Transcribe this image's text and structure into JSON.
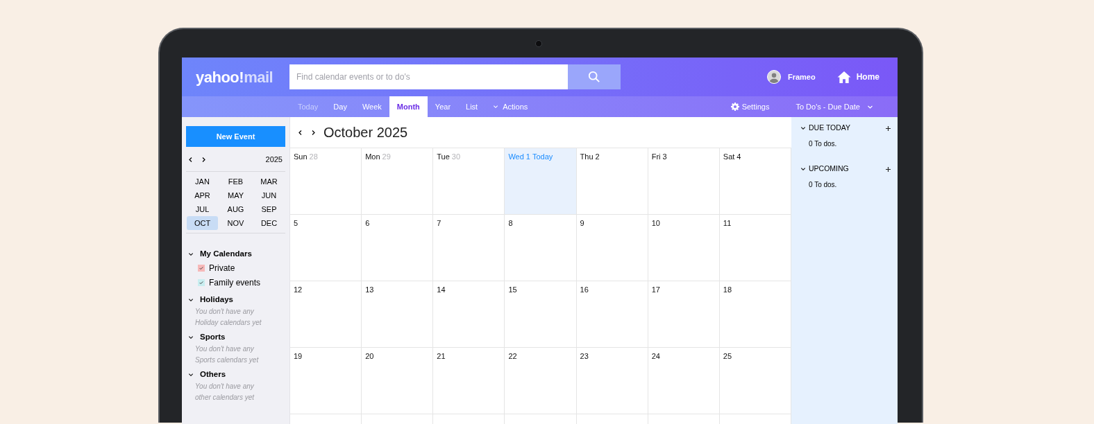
{
  "header": {
    "logo": {
      "brand": "yahoo!",
      "product": "mail"
    },
    "search": {
      "placeholder": "Find calendar events or to do's"
    },
    "account": {
      "name": "Frameo"
    },
    "home": {
      "label": "Home"
    }
  },
  "toolbar": {
    "tabs": [
      {
        "label": "Today",
        "selected": false,
        "disabled": true,
        "kind": "tab"
      },
      {
        "label": "Day",
        "selected": false,
        "disabled": false,
        "kind": "tab"
      },
      {
        "label": "Week",
        "selected": false,
        "disabled": false,
        "kind": "tab"
      },
      {
        "label": "Month",
        "selected": true,
        "disabled": false,
        "kind": "tab"
      },
      {
        "label": "Year",
        "selected": false,
        "disabled": false,
        "kind": "tab"
      },
      {
        "label": "List",
        "selected": false,
        "disabled": false,
        "kind": "tab"
      },
      {
        "label": "Actions",
        "selected": false,
        "disabled": false,
        "kind": "menu"
      }
    ],
    "settings": {
      "label": "Settings"
    },
    "todo_sort": {
      "label": "To Do's - Due Date"
    }
  },
  "sidebar": {
    "new_event": {
      "label": "New Event"
    },
    "year": "2025",
    "months": [
      {
        "label": "JAN",
        "selected": false
      },
      {
        "label": "FEB",
        "selected": false
      },
      {
        "label": "MAR",
        "selected": false
      },
      {
        "label": "APR",
        "selected": false
      },
      {
        "label": "MAY",
        "selected": false
      },
      {
        "label": "JUN",
        "selected": false
      },
      {
        "label": "JUL",
        "selected": false
      },
      {
        "label": "AUG",
        "selected": false
      },
      {
        "label": "SEP",
        "selected": false
      },
      {
        "label": "OCT",
        "selected": true
      },
      {
        "label": "NOV",
        "selected": false
      },
      {
        "label": "DEC",
        "selected": false
      }
    ],
    "groups": [
      {
        "name": "My Calendars",
        "expanded": true,
        "calendars": [
          {
            "name": "Private",
            "checked": true,
            "color": "#f7b9b9"
          },
          {
            "name": "Family events",
            "checked": true,
            "color": "#c9eef0"
          }
        ]
      },
      {
        "name": "Holidays",
        "expanded": true,
        "empty_text": "You don't have any Holiday calendars yet"
      },
      {
        "name": "Sports",
        "expanded": true,
        "empty_text": "You don't have any Sports calendars yet"
      },
      {
        "name": "Others",
        "expanded": true,
        "empty_text": "You don't have any other calendars yet"
      }
    ]
  },
  "calendar": {
    "title": "October 2025",
    "weeks": [
      [
        {
          "weekday": "Sun",
          "day": "28",
          "outside": true,
          "today": false
        },
        {
          "weekday": "Mon",
          "day": "29",
          "outside": true,
          "today": false
        },
        {
          "weekday": "Tue",
          "day": "30",
          "outside": true,
          "today": false
        },
        {
          "weekday": "Wed",
          "day": "1",
          "today_label": "Today",
          "outside": false,
          "today": true
        },
        {
          "weekday": "Thu",
          "day": "2",
          "outside": false,
          "today": false
        },
        {
          "weekday": "Fri",
          "day": "3",
          "outside": false,
          "today": false
        },
        {
          "weekday": "Sat",
          "day": "4",
          "outside": false,
          "today": false
        }
      ],
      [
        {
          "day": "5",
          "outside": false,
          "today": false
        },
        {
          "day": "6",
          "outside": false,
          "today": false
        },
        {
          "day": "7",
          "outside": false,
          "today": false
        },
        {
          "day": "8",
          "outside": false,
          "today": false
        },
        {
          "day": "9",
          "outside": false,
          "today": false
        },
        {
          "day": "10",
          "outside": false,
          "today": false
        },
        {
          "day": "11",
          "outside": false,
          "today": false
        }
      ],
      [
        {
          "day": "12",
          "outside": false,
          "today": false
        },
        {
          "day": "13",
          "outside": false,
          "today": false
        },
        {
          "day": "14",
          "outside": false,
          "today": false
        },
        {
          "day": "15",
          "outside": false,
          "today": false
        },
        {
          "day": "16",
          "outside": false,
          "today": false
        },
        {
          "day": "17",
          "outside": false,
          "today": false
        },
        {
          "day": "18",
          "outside": false,
          "today": false
        }
      ],
      [
        {
          "day": "19",
          "outside": false,
          "today": false
        },
        {
          "day": "20",
          "outside": false,
          "today": false
        },
        {
          "day": "21",
          "outside": false,
          "today": false
        },
        {
          "day": "22",
          "outside": false,
          "today": false
        },
        {
          "day": "23",
          "outside": false,
          "today": false
        },
        {
          "day": "24",
          "outside": false,
          "today": false
        },
        {
          "day": "25",
          "outside": false,
          "today": false
        }
      ]
    ]
  },
  "todos": {
    "sections": [
      {
        "title": "DUE TODAY",
        "expanded": true,
        "summary": "0 To dos."
      },
      {
        "title": "UPCOMING",
        "expanded": true,
        "summary": "0 To dos."
      }
    ]
  }
}
